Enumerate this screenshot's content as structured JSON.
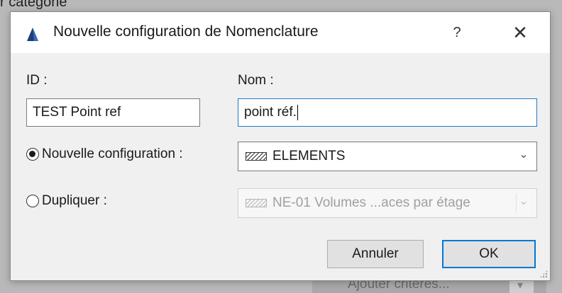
{
  "background": {
    "top_text": "r catégorie",
    "bottom_widget_text": "Ajouter critères..."
  },
  "dialog": {
    "title": "Nouvelle configuration de Nomenclature",
    "help_label": "?",
    "close_label": "✕",
    "id_label": "ID :",
    "id_value": "TEST Point ref",
    "nom_label": "Nom :",
    "nom_value": "point réf.",
    "new_config_label": "Nouvelle configuration :",
    "new_config_selected": true,
    "new_config_value": "ELEMENTS",
    "duplicate_label": "Dupliquer :",
    "duplicate_selected": false,
    "duplicate_value": "NE-01 Volumes ...aces par étage",
    "cancel_label": "Annuler",
    "ok_label": "OK"
  },
  "icons": {
    "app": "archicad-app-icon",
    "help": "help-icon",
    "close": "close-icon",
    "dropdown": "chevron-down-icon",
    "hatch": "hatch-pattern-icon"
  },
  "colors": {
    "focus_border": "#1d79c9",
    "default_button_border": "#0078d7"
  }
}
